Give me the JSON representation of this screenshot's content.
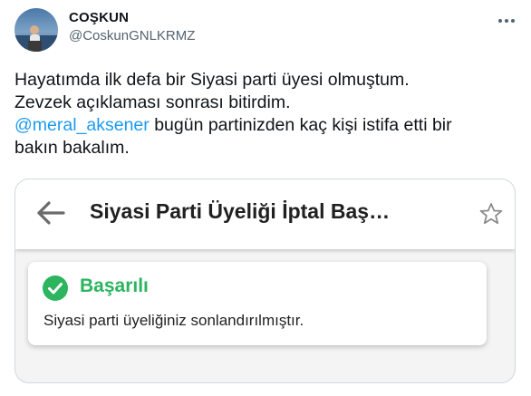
{
  "author": {
    "display_name": "COŞKUN",
    "handle": "@CoskunGNLKRMZ",
    "avatar_icon": "profile-photo"
  },
  "tweet": {
    "line1": "Hayatımda ilk defa bir Siyasi parti üyesi olmuştum.",
    "line2": "Zevzek açıklaması sonrası bitirdim.",
    "mention": "@meral_aksener",
    "line3_rest": " bugün partinizden kaç kişi istifa etti bir",
    "line4": "bakın bakalım."
  },
  "screenshot": {
    "app_title": "Siyasi Parti Üyeliği İptal Baş…",
    "alert_title": "Başarılı",
    "alert_message": "Siyasi parti üyeliğiniz sonlandırılmıştır.",
    "icons": {
      "back": "arrow-left-icon",
      "star": "star-outline-icon",
      "success": "check-circle-icon",
      "more": "more-options-icon"
    }
  },
  "colors": {
    "mention": "#1d9bf0",
    "success": "#2cb45f",
    "secondary_text": "#536471"
  }
}
